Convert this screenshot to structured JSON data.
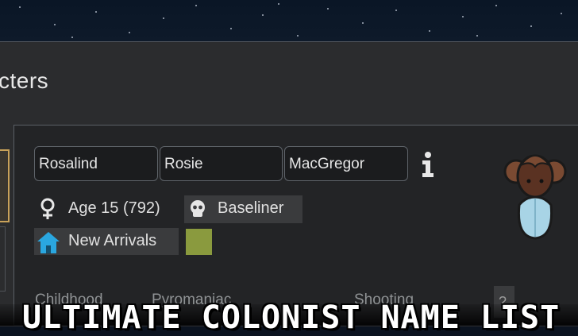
{
  "window": {
    "title": "cters"
  },
  "names": {
    "first": "Rosalind",
    "nick": "Rosie",
    "last": "MacGregor"
  },
  "pawn": {
    "age": "Age 15 (792)",
    "xenotype": "Baseliner",
    "faction": "New Arrivals",
    "faction_color": "#8a9a3e"
  },
  "backstory_row": {
    "childhood_label": "Childhood",
    "childhood_value": "Pyromaniac",
    "skill_label": "Shooting",
    "help": "?"
  },
  "banner": {
    "text": "ULTIMATE COLONIST NAME LIST"
  },
  "icons": {
    "info": "info-icon",
    "gender": "female-icon",
    "xenotype": "skull-icon",
    "faction": "house-icon"
  }
}
